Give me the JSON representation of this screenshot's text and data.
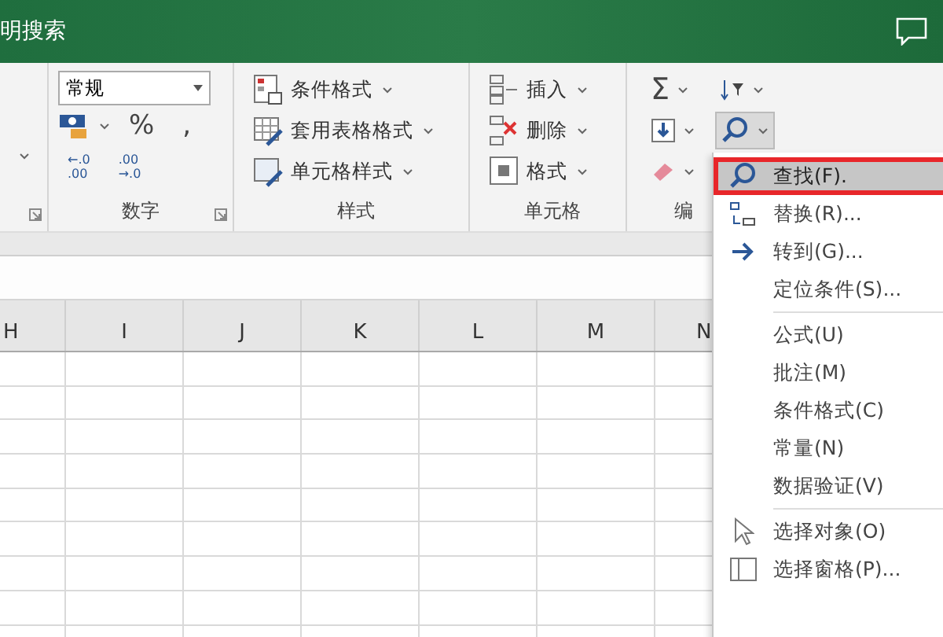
{
  "title_bar": {
    "search_text": "明搜索"
  },
  "ribbon": {
    "number_group": {
      "format": "常规",
      "percent": "%",
      "comma": ",",
      "decimal_increase": [
        "←.0",
        ".00"
      ],
      "decimal_decrease": [
        ".00",
        "→.0"
      ],
      "label": "数字"
    },
    "styles_group": {
      "items": [
        {
          "kind": "conditional",
          "label": "条件格式"
        },
        {
          "kind": "table",
          "label": "套用表格格式"
        },
        {
          "kind": "cellstyle",
          "label": "单元格样式"
        }
      ],
      "label": "样式"
    },
    "cells_group": {
      "items": [
        {
          "kind": "insert",
          "label": "插入"
        },
        {
          "kind": "delete",
          "label": "删除"
        },
        {
          "kind": "format",
          "label": "格式"
        }
      ],
      "label": "单元格"
    },
    "editing_group": {
      "autosum": "Σ",
      "find_pressed": true,
      "label": "编"
    }
  },
  "column_headers": [
    "H",
    "I",
    "J",
    "K",
    "L",
    "M",
    "N"
  ],
  "menu": {
    "sections": [
      {
        "items": [
          {
            "kind": "find",
            "label": "查找(F).",
            "selected": true
          },
          {
            "kind": "replace",
            "label": "替换(R)...",
            "selected": false
          },
          {
            "kind": "goto",
            "label": "转到(G)...",
            "selected": false
          },
          {
            "kind": "plain",
            "label": "定位条件(S)...",
            "selected": false
          }
        ]
      },
      {
        "items": [
          {
            "kind": "plain",
            "label": "公式(U)",
            "selected": false
          },
          {
            "kind": "plain",
            "label": "批注(M)",
            "selected": false
          },
          {
            "kind": "plain",
            "label": "条件格式(C)",
            "selected": false
          },
          {
            "kind": "plain",
            "label": "常量(N)",
            "selected": false
          },
          {
            "kind": "plain",
            "label": "数据验证(V)",
            "selected": false
          }
        ]
      },
      {
        "items": [
          {
            "kind": "select",
            "label": "选择对象(O)",
            "selected": false
          },
          {
            "kind": "pane",
            "label": "选择窗格(P)...",
            "selected": false
          }
        ]
      }
    ]
  }
}
